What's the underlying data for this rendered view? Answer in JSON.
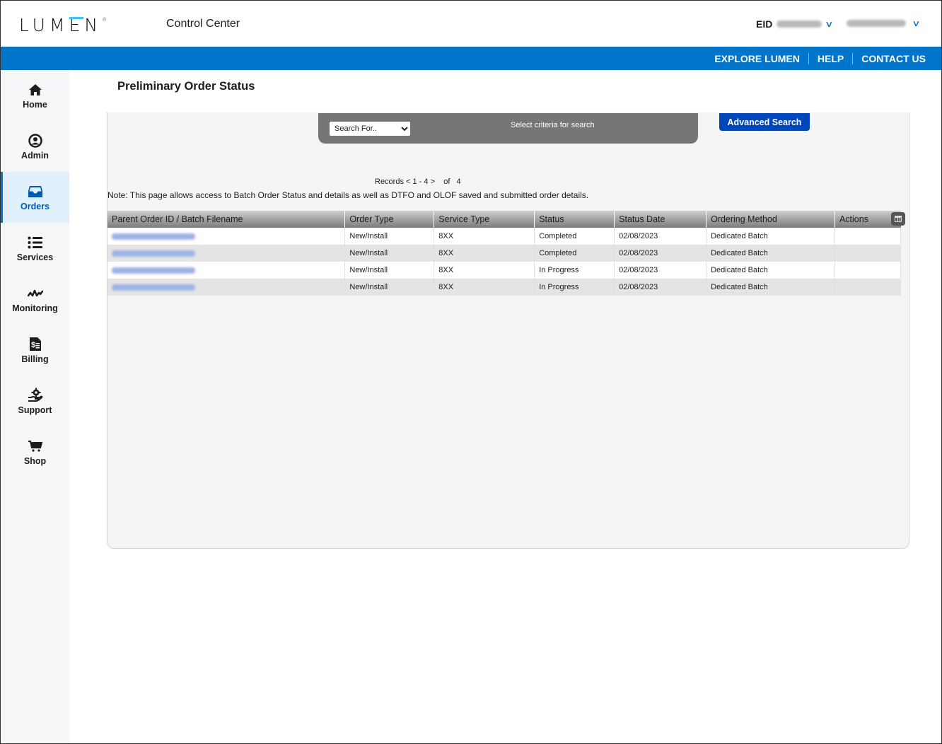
{
  "header": {
    "logo": "LUMEN",
    "app_title": "Control Center",
    "eid_label": "EID",
    "eid_value": "[redacted]",
    "username": "[redacted]"
  },
  "nav_links": [
    "EXPLORE LUMEN",
    "HELP",
    "CONTACT US"
  ],
  "sidebar": {
    "items": [
      {
        "label": "Home",
        "icon": "home-icon"
      },
      {
        "label": "Admin",
        "icon": "user-circle-icon"
      },
      {
        "label": "Orders",
        "icon": "inbox-tray-icon",
        "active": true
      },
      {
        "label": "Services",
        "icon": "list-icon"
      },
      {
        "label": "Monitoring",
        "icon": "pulse-icon"
      },
      {
        "label": "Billing",
        "icon": "invoice-icon"
      },
      {
        "label": "Support",
        "icon": "hand-gear-icon"
      },
      {
        "label": "Shop",
        "icon": "cart-icon"
      }
    ]
  },
  "page": {
    "title": "Preliminary Order Status",
    "search": {
      "select_value": "Search For..",
      "hint": "Select criteria for search",
      "advanced_label": "Advanced Search"
    },
    "records": "Records < 1 - 4 >    of   4",
    "note": "Note: This page allows access to Batch Order Status and details as well as DTFO and OLOF saved and submitted order details."
  },
  "table": {
    "columns": [
      "Parent Order ID / Batch Filename",
      "Order Type",
      "Service Type",
      "Status",
      "Status Date",
      "Ordering Method",
      "Actions"
    ],
    "rows": [
      {
        "id": "[redacted].TXT",
        "order_type": "New/Install",
        "service_type": "8XX",
        "status": "Completed",
        "status_date": "02/08/2023",
        "method": "Dedicated Batch",
        "actions": ""
      },
      {
        "id": "[redacted].TXT",
        "order_type": "New/Install",
        "service_type": "8XX",
        "status": "Completed",
        "status_date": "02/08/2023",
        "method": "Dedicated Batch",
        "actions": ""
      },
      {
        "id": "[redacted].TXT",
        "order_type": "New/Install",
        "service_type": "8XX",
        "status": "In Progress",
        "status_date": "02/08/2023",
        "method": "Dedicated Batch",
        "actions": ""
      },
      {
        "id": "[redacted].TXT",
        "order_type": "New/Install",
        "service_type": "8XX",
        "status": "In Progress",
        "status_date": "02/08/2023",
        "method": "Dedicated Batch",
        "actions": ""
      }
    ]
  },
  "colors": {
    "brand_blue": "#0075c9",
    "button_blue": "#0047bb",
    "accent_cyan": "#38c6f4"
  }
}
